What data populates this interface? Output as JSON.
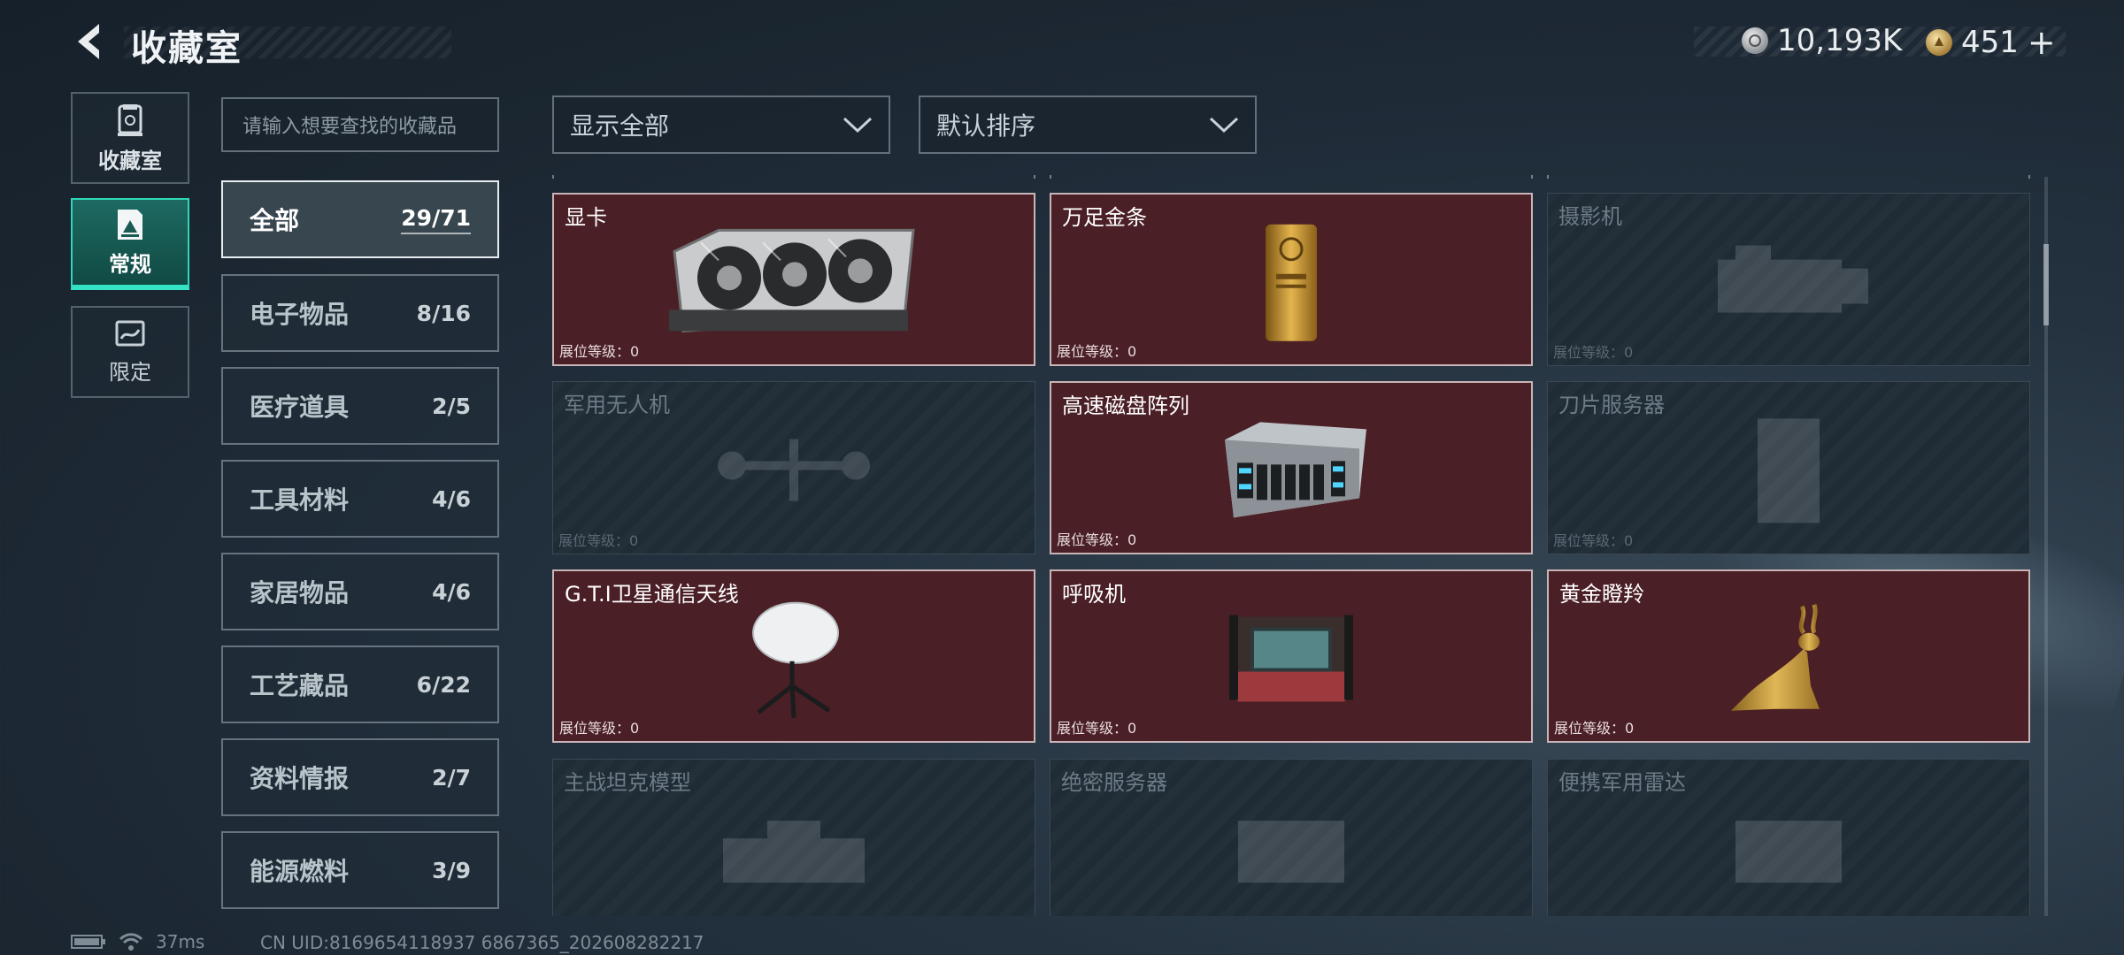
{
  "header": {
    "title": "收藏室",
    "currency_silver": "10,193K",
    "currency_gold": "451",
    "add_symbol": "+"
  },
  "rail": [
    {
      "label": "收藏室",
      "icon": "collection-room-icon"
    },
    {
      "label": "常规",
      "icon": "regular-icon"
    },
    {
      "label": "限定",
      "icon": "limited-icon"
    }
  ],
  "search": {
    "placeholder": "请输入想要查找的收藏品"
  },
  "categories": [
    {
      "name": "全部",
      "count": "29/71"
    },
    {
      "name": "电子物品",
      "count": "8/16"
    },
    {
      "name": "医疗道具",
      "count": "2/5"
    },
    {
      "name": "工具材料",
      "count": "4/6"
    },
    {
      "name": "家居物品",
      "count": "4/6"
    },
    {
      "name": "工艺藏品",
      "count": "6/22"
    },
    {
      "name": "资料情报",
      "count": "2/7"
    },
    {
      "name": "能源燃料",
      "count": "3/9"
    }
  ],
  "filters": {
    "show": "显示全部",
    "sort": "默认排序"
  },
  "items": [
    {
      "name": "显卡",
      "level_label": "展位等级：0",
      "owned": true,
      "icon": "graphics-card-icon"
    },
    {
      "name": "万足金条",
      "level_label": "展位等级：0",
      "owned": true,
      "icon": "gold-bar-icon"
    },
    {
      "name": "摄影机",
      "level_label": "展位等级：0",
      "owned": false,
      "icon": "camera-icon"
    },
    {
      "name": "军用无人机",
      "level_label": "展位等级：0",
      "owned": false,
      "icon": "drone-icon"
    },
    {
      "name": "高速磁盘阵列",
      "level_label": "展位等级：0",
      "owned": true,
      "icon": "disk-array-icon"
    },
    {
      "name": "刀片服务器",
      "level_label": "展位等级：0",
      "owned": false,
      "icon": "blade-server-icon"
    },
    {
      "name": "G.T.I卫星通信天线",
      "level_label": "展位等级：0",
      "owned": true,
      "icon": "satellite-dish-icon"
    },
    {
      "name": "呼吸机",
      "level_label": "展位等级：0",
      "owned": true,
      "icon": "ventilator-icon"
    },
    {
      "name": "黄金瞪羚",
      "level_label": "展位等级：0",
      "owned": true,
      "icon": "golden-gazelle-icon"
    },
    {
      "name": "主战坦克模型",
      "level_label": "",
      "owned": false,
      "icon": "tank-model-icon"
    },
    {
      "name": "绝密服务器",
      "level_label": "",
      "owned": false,
      "icon": "secret-server-icon"
    },
    {
      "name": "便携军用雷达",
      "level_label": "",
      "owned": false,
      "icon": "portable-radar-icon"
    }
  ],
  "footer": {
    "ping": "37ms",
    "uid": "CN UID:8169654118937 6867365_202608282217"
  }
}
